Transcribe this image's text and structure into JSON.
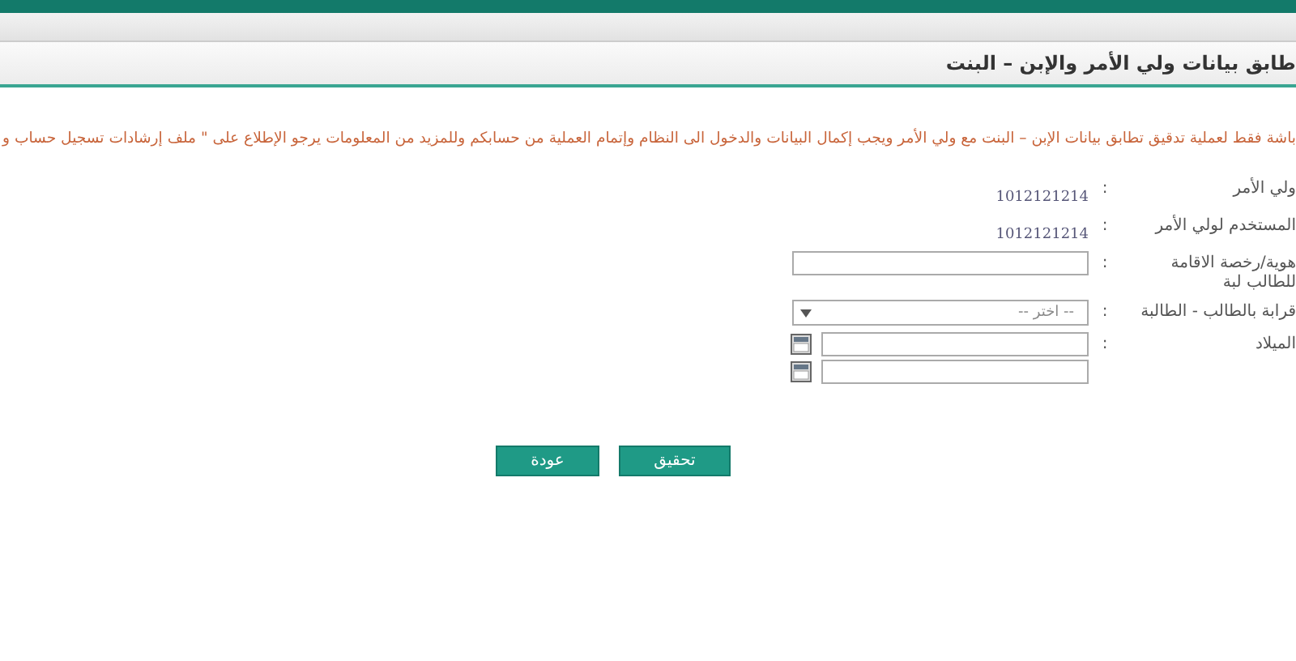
{
  "header": {
    "title": "طابق بيانات ولي الأمر والإبن – البنت"
  },
  "notice": "باشة فقط لعملية تدقيق تطابق بيانات الإبن – البنت مع ولي الأمر ويجب إكمال البيانات والدخول الى النظام وإتمام العملية من حسابكم وللمزيد من المعلومات يرجو الإطلاع على \" ملف إرشادات تسجيل حساب و",
  "fields": [
    {
      "kind": "text",
      "label": "ولي الأمر",
      "colon": ":",
      "value": "1012121214"
    },
    {
      "kind": "text",
      "label": "المستخدم لولي الأمر",
      "colon": ":",
      "value": "1012121214"
    },
    {
      "kind": "input",
      "label": "هوية/رخصة الاقامة للطالب لبة",
      "colon": ":"
    },
    {
      "kind": "select",
      "label": "قرابة بالطالب - الطالبة",
      "colon": ":",
      "placeholder": "-- اختر --"
    },
    {
      "kind": "date",
      "label": "الميلاد",
      "colon": ":"
    }
  ],
  "buttons": [
    {
      "label": "تحقيق"
    },
    {
      "label": "عودة"
    }
  ]
}
